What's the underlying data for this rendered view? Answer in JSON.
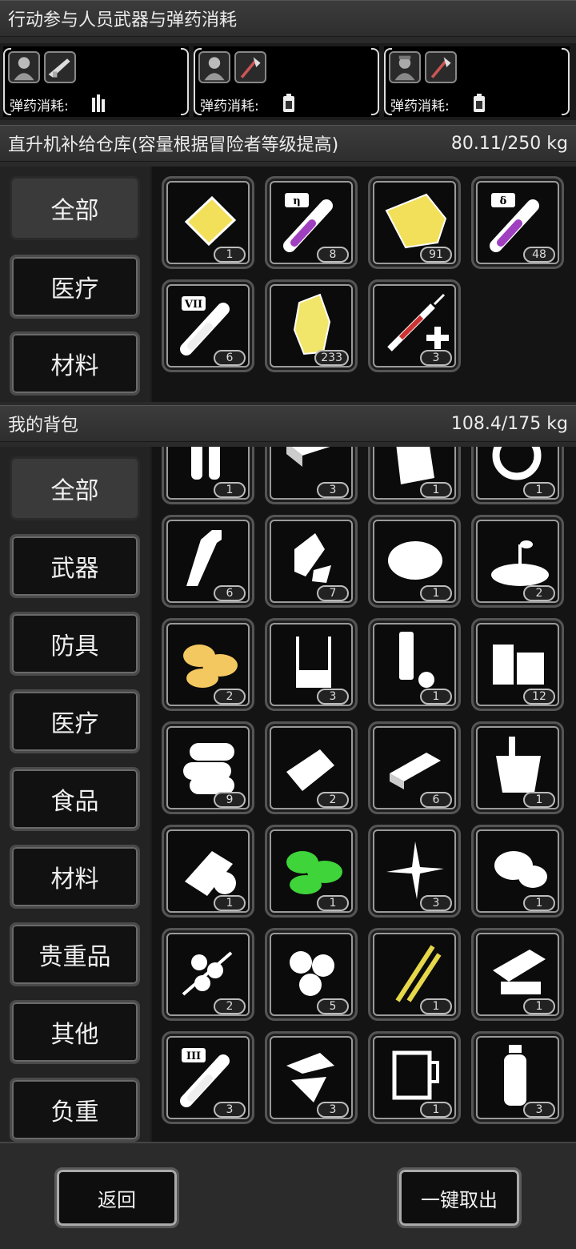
{
  "participants_header": {
    "title": "行动参与人员武器与弹药消耗"
  },
  "participants": [
    {
      "ammo_label": "弹药消耗:",
      "portrait_icon": "survivor-portrait-icon",
      "weapon_icon": "rifle-icon",
      "ammo_icon": "bullets-icon"
    },
    {
      "ammo_label": "弹药消耗:",
      "portrait_icon": "survivor-portrait-icon",
      "weapon_icon": "axe-icon",
      "ammo_icon": "battery-icon"
    },
    {
      "ammo_label": "弹药消耗:",
      "portrait_icon": "soldier-portrait-icon",
      "weapon_icon": "axe-icon",
      "ammo_icon": "battery-icon"
    }
  ],
  "warehouse": {
    "title": "直升机补给仓库(容量根据冒险者等级提高)",
    "capacity": "80.11/250 kg",
    "tabs": [
      "全部",
      "医疗",
      "材料"
    ],
    "items": [
      {
        "icon": "gold-plate-icon",
        "count": "1"
      },
      {
        "icon": "eta-potion-tube-icon",
        "count": "8"
      },
      {
        "icon": "gold-cloth-icon",
        "count": "91"
      },
      {
        "icon": "delta-potion-tube-icon",
        "count": "48"
      },
      {
        "icon": "vii-potion-tube-icon",
        "count": "6"
      },
      {
        "icon": "gold-ore-icon",
        "count": "233"
      },
      {
        "icon": "medical-syringe-icon",
        "count": "3"
      }
    ]
  },
  "backpack": {
    "title": "我的背包",
    "capacity": "108.4/175 kg",
    "tabs": [
      "全部",
      "武器",
      "防具",
      "医疗",
      "食品",
      "材料",
      "贵重品",
      "其他",
      "负重"
    ],
    "items": [
      {
        "icon": "pipes-icon",
        "count": "1"
      },
      {
        "icon": "box-icon",
        "count": "3"
      },
      {
        "icon": "map-bag-icon",
        "count": "1"
      },
      {
        "icon": "ring-icon",
        "count": "1"
      },
      {
        "icon": "bottle-icon",
        "count": "6"
      },
      {
        "icon": "crumpled-can-icon",
        "count": "7"
      },
      {
        "icon": "powder-pile-icon",
        "count": "1"
      },
      {
        "icon": "soil-sprout-icon",
        "count": "2"
      },
      {
        "icon": "yellow-leaves-icon",
        "count": "2"
      },
      {
        "icon": "beaker-icon",
        "count": "3"
      },
      {
        "icon": "tube-cap-icon",
        "count": "1"
      },
      {
        "icon": "wood-planks-icon",
        "count": "12"
      },
      {
        "icon": "logs-icon",
        "count": "9"
      },
      {
        "icon": "bread-icon",
        "count": "2"
      },
      {
        "icon": "bar-icon",
        "count": "6"
      },
      {
        "icon": "bucket-icon",
        "count": "1"
      },
      {
        "icon": "bandage-icon",
        "count": "1"
      },
      {
        "icon": "green-leaves-icon",
        "count": "1"
      },
      {
        "icon": "flower-icon",
        "count": "3"
      },
      {
        "icon": "leaf-icon",
        "count": "1"
      },
      {
        "icon": "berry-branch-icon",
        "count": "2"
      },
      {
        "icon": "nuts-icon",
        "count": "5"
      },
      {
        "icon": "chopsticks-icon",
        "count": "1"
      },
      {
        "icon": "machine-parts-icon",
        "count": "1"
      },
      {
        "icon": "iii-potion-tube-icon",
        "count": "3"
      },
      {
        "icon": "broken-shards-icon",
        "count": "3"
      },
      {
        "icon": "herbal-jug-icon",
        "count": "1"
      },
      {
        "icon": "water-bottle-icon",
        "count": "3"
      }
    ]
  },
  "footer": {
    "back_label": "返回",
    "take_all_label": "一键取出"
  }
}
